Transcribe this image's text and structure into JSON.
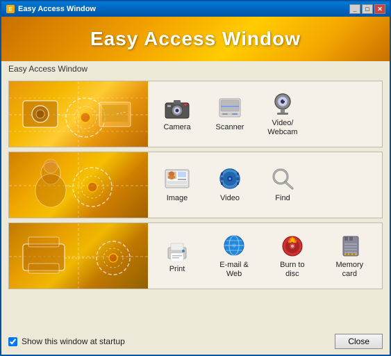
{
  "window": {
    "title": "Easy Access Window",
    "titlebar_buttons": [
      "_",
      "□",
      "✕"
    ]
  },
  "header": {
    "title": "Easy Access Window"
  },
  "breadcrumb": "Easy Access Window",
  "sections": [
    {
      "id": "section-capture",
      "icons": [
        {
          "id": "camera",
          "label": "Camera"
        },
        {
          "id": "scanner",
          "label": "Scanner"
        },
        {
          "id": "webcam",
          "label": "Video/\nWebcam"
        }
      ]
    },
    {
      "id": "section-media",
      "icons": [
        {
          "id": "image",
          "label": "Image"
        },
        {
          "id": "video",
          "label": "Video"
        },
        {
          "id": "find",
          "label": "Find"
        }
      ]
    },
    {
      "id": "section-output",
      "icons": [
        {
          "id": "print",
          "label": "Print"
        },
        {
          "id": "email",
          "label": "E-mail & Web"
        },
        {
          "id": "burn",
          "label": "Burn to disc"
        },
        {
          "id": "memcard",
          "label": "Memory card"
        }
      ]
    }
  ],
  "footer": {
    "checkbox_label": "Show this window at startup",
    "checkbox_checked": true,
    "close_button": "Close"
  }
}
